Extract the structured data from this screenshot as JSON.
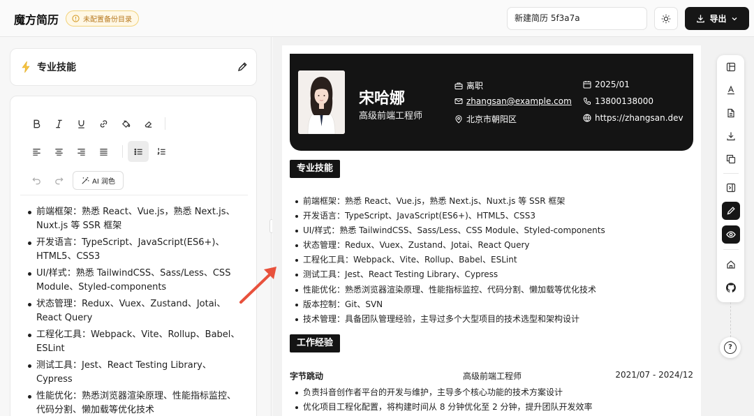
{
  "app": {
    "title": "魔方简历",
    "backup_badge": "未配置备份目录",
    "resume_name": "新建简历 5f3a7a",
    "export_label": "导出"
  },
  "editor": {
    "section_title": "专业技能",
    "ai_button": "AI 润色",
    "skills": [
      "前端框架：熟悉 React、Vue.js，熟悉 Next.js、Nuxt.js 等 SSR 框架",
      "开发语言：TypeScript、JavaScript(ES6+)、HTML5、CSS3",
      "UI/样式：熟悉 TailwindCSS、Sass/Less、CSS Module、Styled-components",
      "状态管理：Redux、Vuex、Zustand、Jotai、React Query",
      "工程化工具：Webpack、Vite、Rollup、Babel、ESLint",
      "测试工具：Jest、React Testing Library、Cypress",
      "性能优化：熟悉浏览器渲染原理、性能指标监控、代码分割、懒加载等优化技术"
    ]
  },
  "resume": {
    "name": "宋哈娜",
    "title": "高级前端工程师",
    "status": "离职",
    "email": "zhangsan@example.com",
    "location": "北京市朝阳区",
    "date": "2025/01",
    "phone": "13800138000",
    "website": "https://zhangsan.dev",
    "skills_heading": "专业技能",
    "skills": [
      "前端框架：熟悉 React、Vue.js，熟悉 Next.js、Nuxt.js 等 SSR 框架",
      "开发语言：TypeScript、JavaScript(ES6+)、HTML5、CSS3",
      "UI/样式：熟悉 TailwindCSS、Sass/Less、CSS Module、Styled-components",
      "状态管理：Redux、Vuex、Zustand、Jotai、React Query",
      "工程化工具：Webpack、Vite、Rollup、Babel、ESLint",
      "测试工具：Jest、React Testing Library、Cypress",
      "性能优化：熟悉浏览器渲染原理、性能指标监控、代码分割、懒加载等优化技术",
      "版本控制：Git、SVN",
      "技术管理：具备团队管理经验，主导过多个大型项目的技术选型和架构设计"
    ],
    "work_heading": "工作经验",
    "job": {
      "company": "字节跳动",
      "role": "高级前端工程师",
      "period": "2021/07 - 2024/12",
      "items": [
        "负责抖音创作者平台的开发与维护，主导多个核心功能的技术方案设计",
        "优化项目工程化配置，将构建时间从 8 分钟优化至 2 分钟，提升团队开发效率"
      ]
    }
  },
  "colors": {
    "dark": "#141414",
    "badge_text": "#b7791f",
    "annotation_arrow": "#e8513c"
  }
}
